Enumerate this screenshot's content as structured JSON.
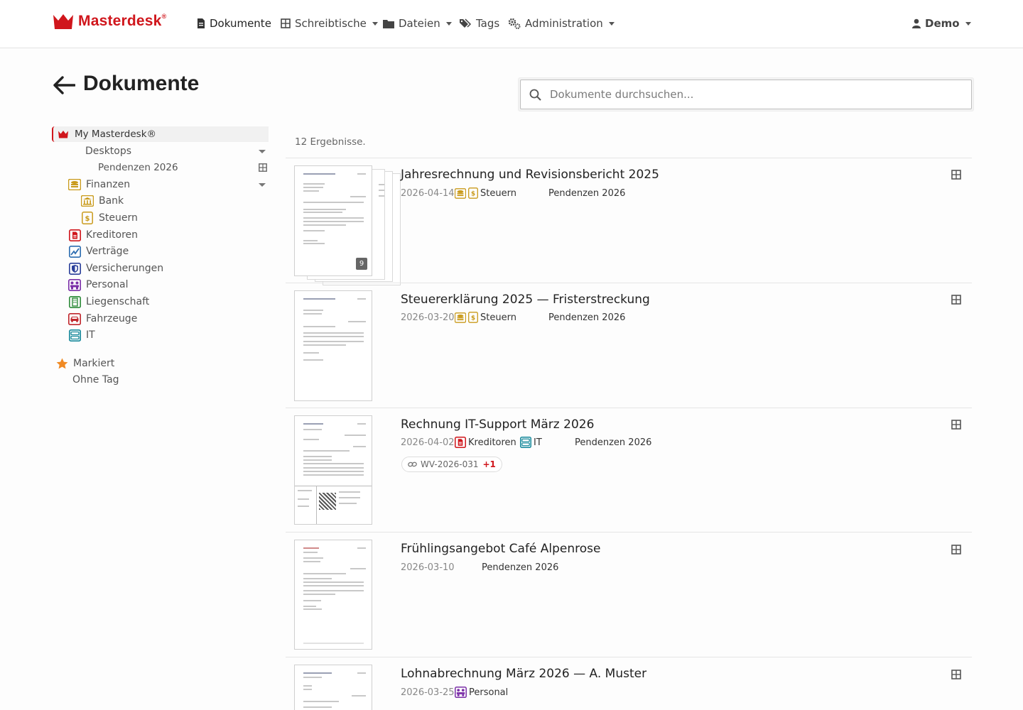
{
  "brand": {
    "name": "Masterdesk",
    "reg": "®",
    "color": "#d0161c"
  },
  "nav": {
    "dokumente": "Dokumente",
    "schreibtische": "Schreibtische",
    "dateien": "Dateien",
    "tags": "Tags",
    "administration": "Administration",
    "user": "Demo"
  },
  "header": {
    "title": "Dokumente",
    "search_placeholder": "Dokumente durchsuchen..."
  },
  "sidebar": {
    "root": "My Masterdesk®",
    "desktops": "Desktops",
    "pendenzen": "Pendenzen 2026",
    "finanzen": "Finanzen",
    "bank": "Bank",
    "steuern": "Steuern",
    "kreditoren": "Kreditoren",
    "vertraege": "Verträge",
    "versicherungen": "Versicherungen",
    "personal": "Personal",
    "liegenschaft": "Liegenschaft",
    "fahrzeuge": "Fahrzeuge",
    "it": "IT",
    "markiert": "Markiert",
    "ohne_tag": "Ohne Tag"
  },
  "results": {
    "count_text": "12 Ergebnisse.",
    "items": [
      {
        "title": "Jahresrechnung und Revisionsbericht 2025",
        "date": "2026-04-14",
        "tags": [
          "Steuern"
        ],
        "desktop": "Pendenzen 2026",
        "pages": "9"
      },
      {
        "title": "Steuererklärung 2025 — Fristerstreckung",
        "date": "2026-03-20",
        "tags": [
          "Steuern"
        ],
        "desktop": "Pendenzen 2026"
      },
      {
        "title": "Rechnung IT-Support März 2026",
        "date": "2026-04-02",
        "tags": [
          "Kreditoren",
          "IT"
        ],
        "desktop": "Pendenzen 2026",
        "link": {
          "label": "WV-2026-031",
          "extra": "+1"
        }
      },
      {
        "title": "Frühlingsangebot Café Alpenrose",
        "date": "2026-03-10",
        "tags": [],
        "desktop": "Pendenzen 2026"
      },
      {
        "title": "Lohnabrechnung März 2026 — A. Muster",
        "date": "2026-03-25",
        "tags": [
          "Personal"
        ]
      }
    ]
  },
  "colors": {
    "finanzen": "#c99a1a",
    "kreditoren": "#d0161c",
    "vertraege": "#2b6cb0",
    "versicherungen": "#2a3f9a",
    "personal": "#7b2fa8",
    "liegenschaft": "#2e8b3a",
    "fahrzeuge": "#c0262c",
    "it": "#14889a",
    "markiert": "#f08a24"
  }
}
